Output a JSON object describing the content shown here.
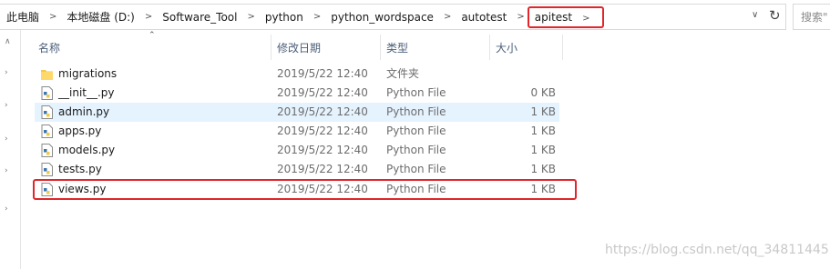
{
  "breadcrumb": [
    "此电脑",
    "本地磁盘 (D:)",
    "Software_Tool",
    "python",
    "python_wordspace",
    "autotest",
    "apitest"
  ],
  "search_placeholder": "搜索\"",
  "columns": {
    "name": "名称",
    "date": "修改日期",
    "type": "类型",
    "size": "大小"
  },
  "files": [
    {
      "name": "migrations",
      "date": "2019/5/22 12:40",
      "type": "文件夹",
      "size": "",
      "icon": "folder-icon"
    },
    {
      "name": "__init__.py",
      "date": "2019/5/22 12:40",
      "type": "Python File",
      "size": "0 KB",
      "icon": "python-file-icon"
    },
    {
      "name": "admin.py",
      "date": "2019/5/22 12:40",
      "type": "Python File",
      "size": "1 KB",
      "icon": "python-file-icon"
    },
    {
      "name": "apps.py",
      "date": "2019/5/22 12:40",
      "type": "Python File",
      "size": "1 KB",
      "icon": "python-file-icon"
    },
    {
      "name": "models.py",
      "date": "2019/5/22 12:40",
      "type": "Python File",
      "size": "1 KB",
      "icon": "python-file-icon"
    },
    {
      "name": "tests.py",
      "date": "2019/5/22 12:40",
      "type": "Python File",
      "size": "1 KB",
      "icon": "python-file-icon"
    },
    {
      "name": "views.py",
      "date": "2019/5/22 12:40",
      "type": "Python File",
      "size": "1 KB",
      "icon": "python-file-icon"
    }
  ],
  "watermark": "https://blog.csdn.net/qq_34811445",
  "colors": {
    "highlight": "#e0252b",
    "selected_row": "#e5f3ff"
  }
}
